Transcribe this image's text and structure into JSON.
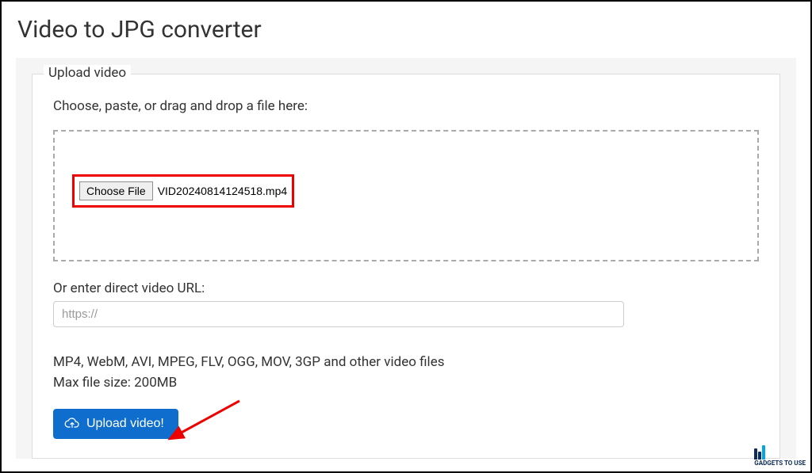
{
  "page": {
    "title": "Video to JPG converter"
  },
  "upload": {
    "legend": "Upload video",
    "instruction": "Choose, paste, or drag and drop a file here:",
    "choose_button": "Choose File",
    "selected_filename": "VID20240814124518.mp4",
    "url_label": "Or enter direct video URL:",
    "url_placeholder": "https://",
    "formats_line": "MP4, WebM, AVI, MPEG, FLV, OGG, MOV, 3GP and other video files",
    "maxsize_line": "Max file size: 200MB",
    "submit_button": "Upload video!"
  },
  "watermark": {
    "text": "GADGETS TO USE"
  }
}
